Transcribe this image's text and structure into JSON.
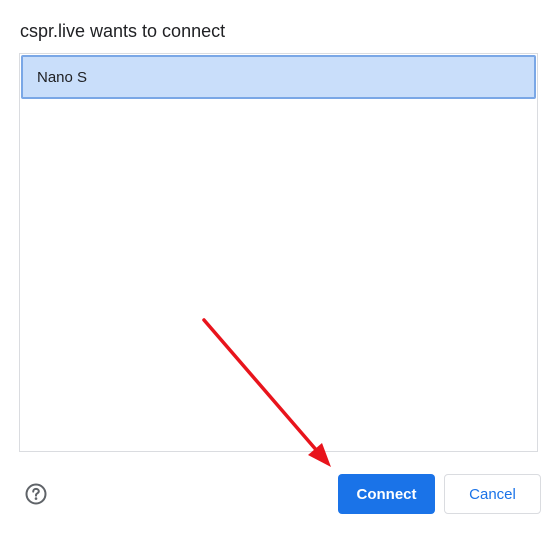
{
  "dialog": {
    "title": "cspr.live wants to connect",
    "devices": [
      {
        "label": "Nano S",
        "selected": true
      }
    ],
    "help_icon": "help-circle-icon",
    "connect_label": "Connect",
    "cancel_label": "Cancel"
  },
  "colors": {
    "primary": "#1a73e8",
    "selected_bg": "#c9defa",
    "selected_border": "#7aa7e6",
    "annotation_arrow": "#e8141c"
  }
}
